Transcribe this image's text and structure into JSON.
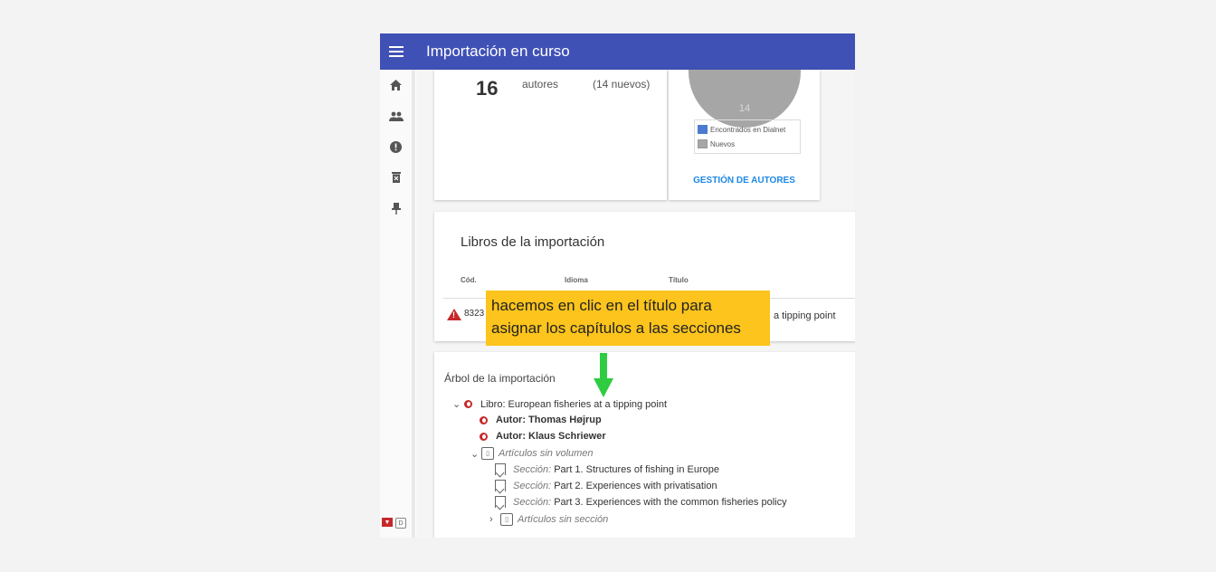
{
  "app": {
    "title": "Importación en curso"
  },
  "sidebar": {
    "icons": [
      "home-icon",
      "people-icon",
      "alert-icon",
      "delete-icon",
      "pin-icon"
    ],
    "bottom_logos": [
      "dialnet-logo",
      "d-logo"
    ]
  },
  "authors": {
    "count": "16",
    "label": "autores",
    "new": "(14 nuevos)"
  },
  "chart": {
    "slice_label": "14",
    "legend": [
      "Encontrados en Dialnet",
      "Nuevos"
    ],
    "legend_colors": [
      "#4a7bd1",
      "#a6a6a6"
    ],
    "link": "GESTIÓN DE AUTORES"
  },
  "libros": {
    "title": "Libros de la importación",
    "headers": [
      "Cód.",
      "Idioma",
      "Título"
    ],
    "row": {
      "cod": "8323",
      "titulo": "a tipping point"
    }
  },
  "tree": {
    "title": "Árbol de la importación",
    "libro_prefix": "Libro:",
    "libro": "European fisheries at a tipping point",
    "autores": [
      "Autor: Thomas Højrup",
      "Autor: Klaus Schriewer"
    ],
    "volumen": "Artículos sin volumen",
    "seccion_prefix": "Sección:",
    "secciones": [
      "Part 1. Structures of fishing in Europe",
      "Part 2. Experiences with privatisation",
      "Part 3. Experiences with the common fisheries policy"
    ],
    "sin_seccion": "Artículos sin sección"
  },
  "callout": {
    "line1": "hacemos en clic en el título para",
    "line2": "asignar los capítulos a las secciones"
  },
  "colors": {
    "accent": "#3f51b5",
    "callout": "#fcc41c",
    "arrow": "#2ecc40",
    "link": "#1e88e5"
  }
}
